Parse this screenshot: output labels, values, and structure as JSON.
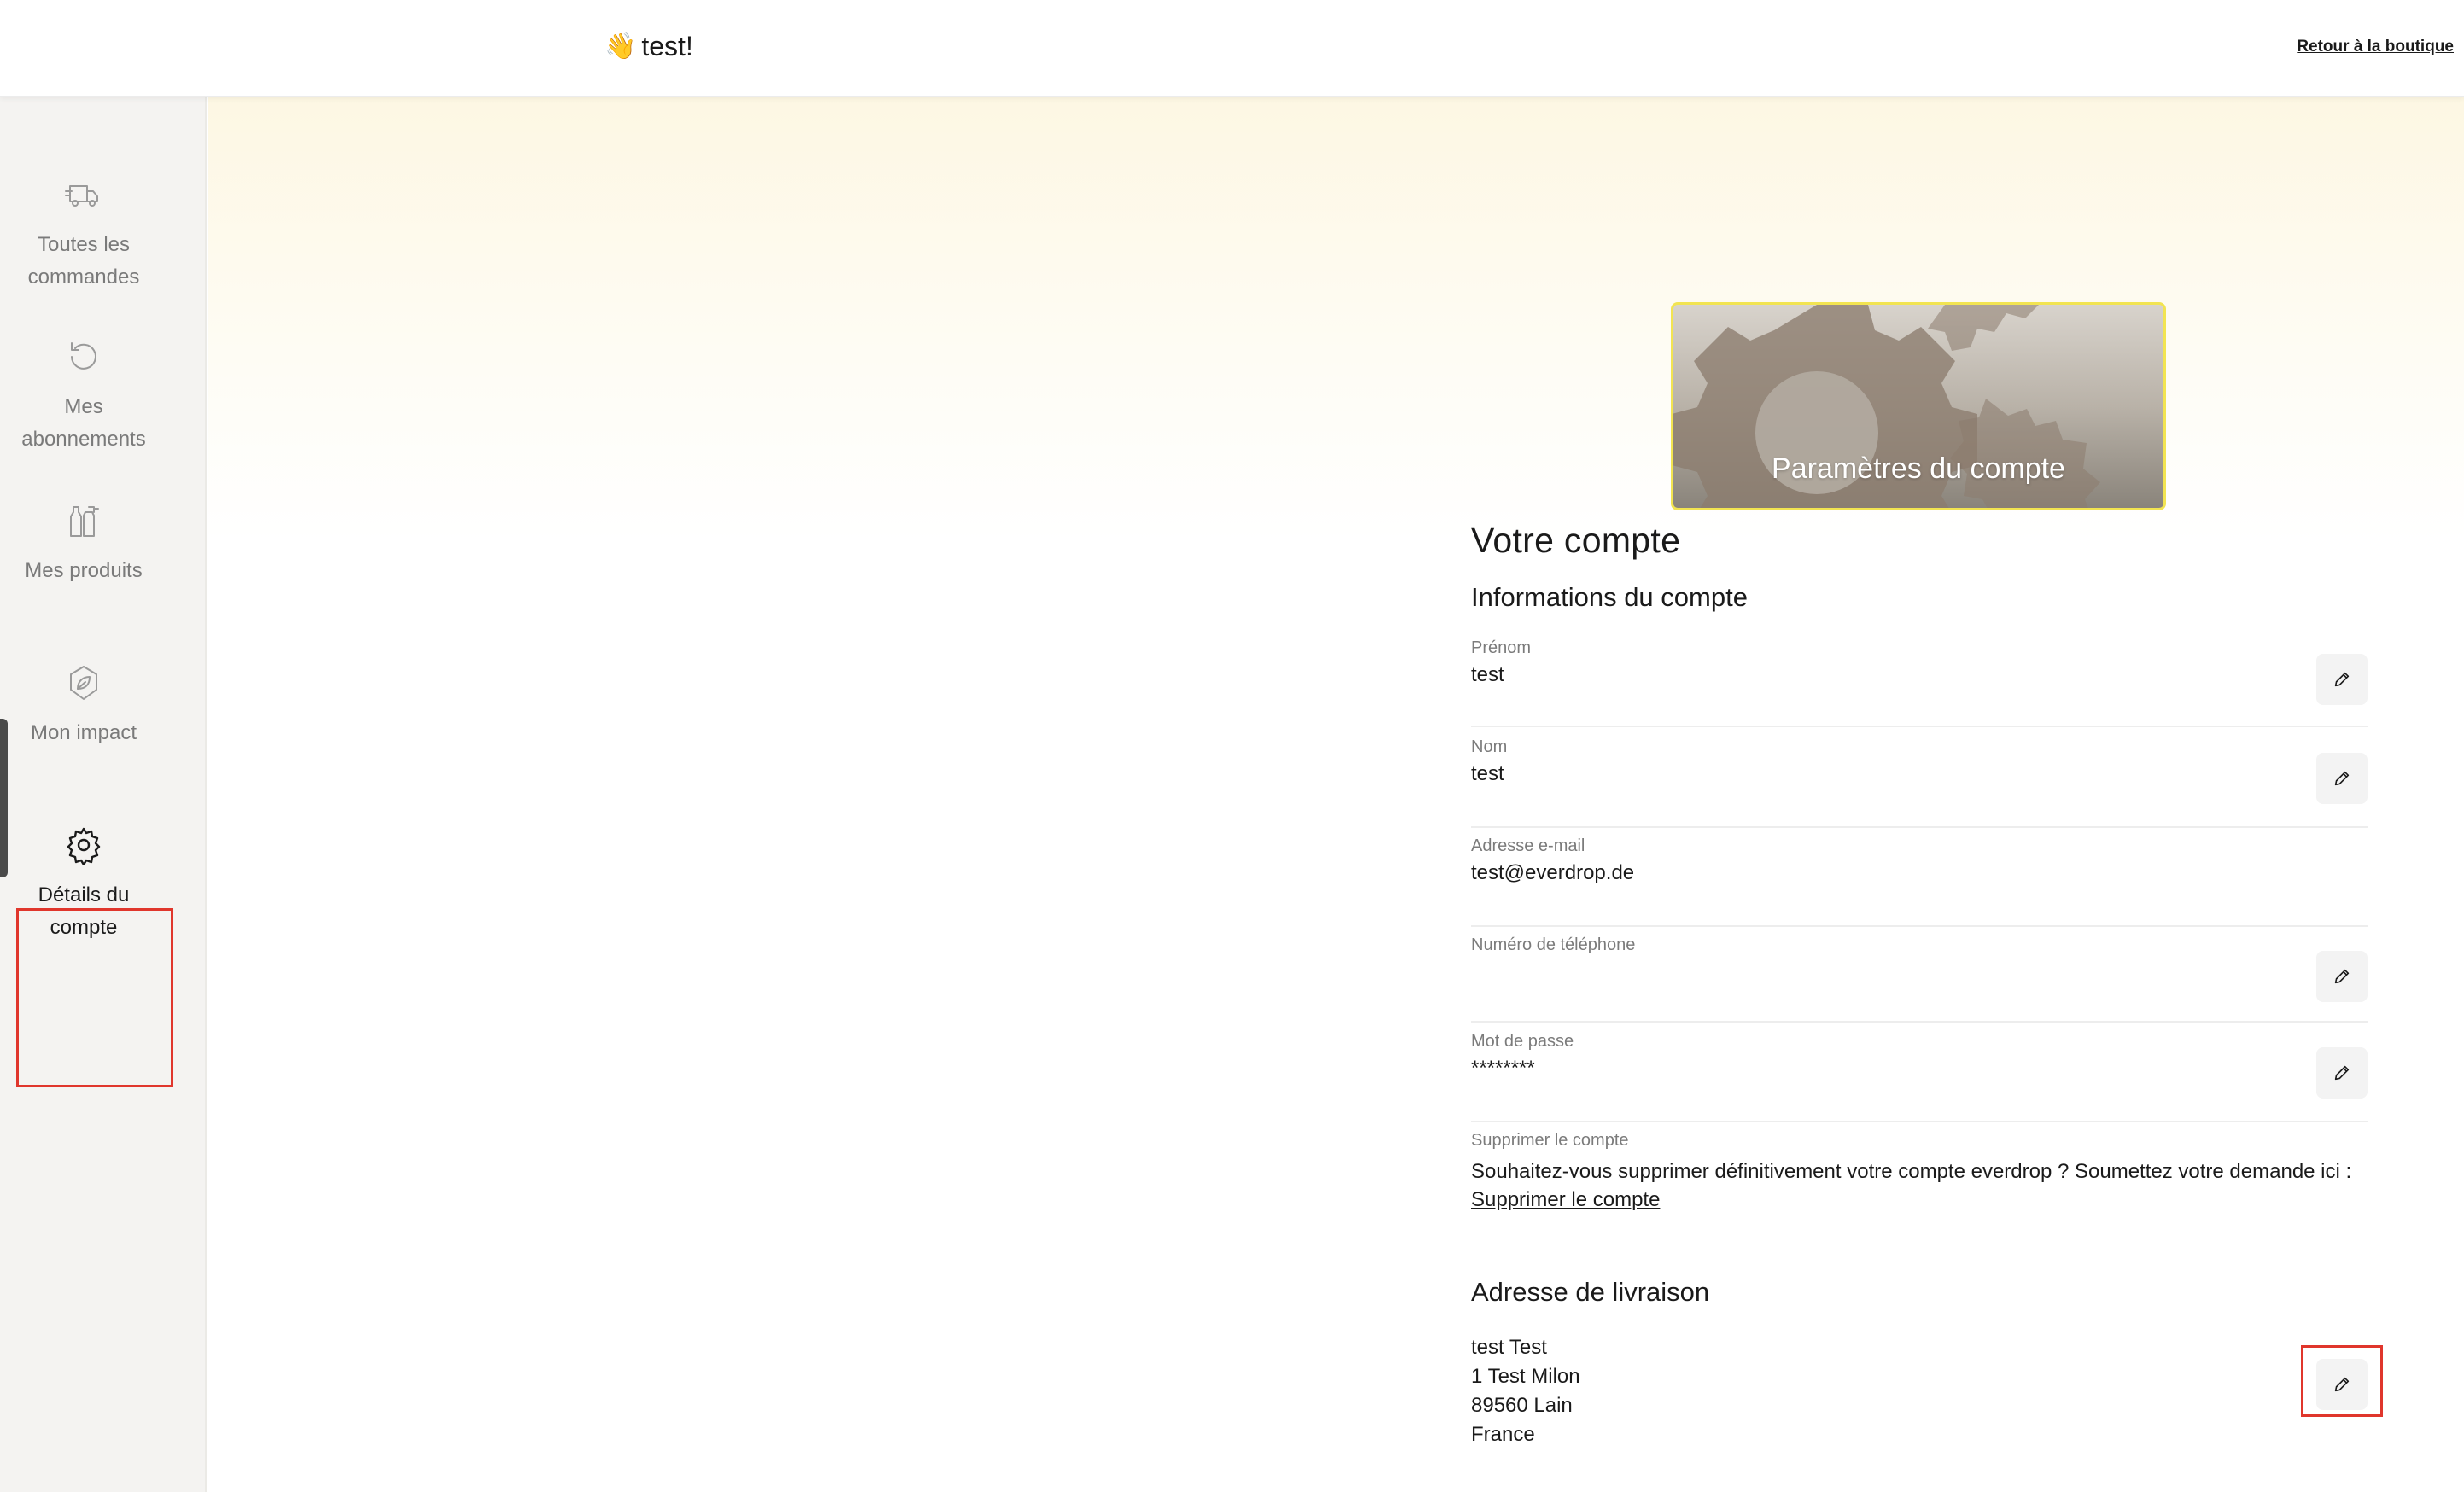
{
  "header": {
    "greeting_emoji": "👋",
    "greeting_text": "test!",
    "back_link": "Retour à la boutique"
  },
  "sidebar": {
    "items": [
      {
        "label": "Toutes les commandes",
        "icon": "truck-icon"
      },
      {
        "label": "Mes abonnements",
        "icon": "refresh-icon"
      },
      {
        "label": "Mes produits",
        "icon": "bottles-icon"
      },
      {
        "label": "Mon impact",
        "icon": "leaf-icon"
      },
      {
        "label": "Détails du compte",
        "icon": "gear-icon",
        "active": true
      }
    ]
  },
  "banner": {
    "title": "Paramètres du compte"
  },
  "account": {
    "heading": "Votre compte",
    "info_heading": "Informations du compte",
    "fields": [
      {
        "label": "Prénom",
        "value": "test",
        "editable": true
      },
      {
        "label": "Nom",
        "value": "test",
        "editable": true
      },
      {
        "label": "Adresse e-mail",
        "value": "test@everdrop.de",
        "editable": false
      },
      {
        "label": "Numéro de téléphone",
        "value": "",
        "editable": true
      },
      {
        "label": "Mot de passe",
        "value": "********",
        "editable": true
      }
    ],
    "delete": {
      "label": "Supprimer le compte",
      "text": "Souhaitez-vous supprimer définitivement votre compte everdrop ? Soumettez votre demande ici :",
      "link": "Supprimer le compte"
    }
  },
  "shipping": {
    "heading": "Adresse de livraison",
    "lines": [
      "test Test",
      "1 Test Milon",
      "89560 Lain",
      "France"
    ]
  },
  "colors": {
    "highlight": "#e0362c",
    "banner_border": "#f2e451"
  }
}
